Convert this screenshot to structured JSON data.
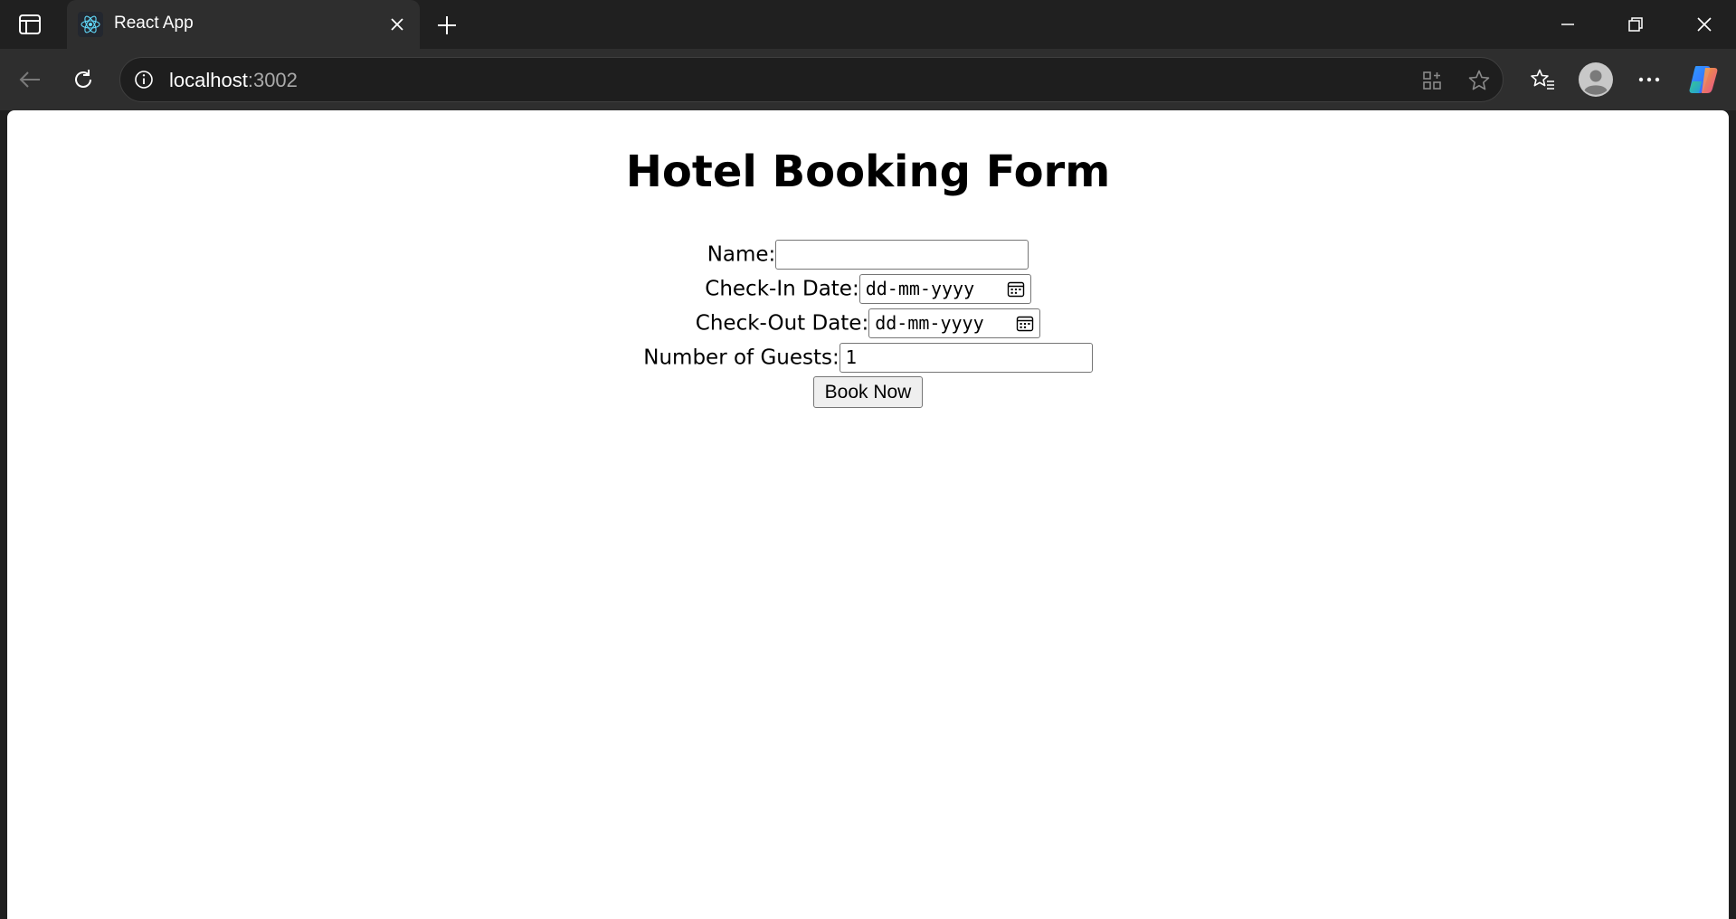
{
  "browser": {
    "tab": {
      "title": "React App",
      "icon": "react-logo-icon"
    },
    "address": {
      "host": "localhost",
      "port": ":3002"
    },
    "accent_color": "#61dafb"
  },
  "page": {
    "title": "Hotel Booking Form",
    "form": {
      "name_label": "Name:",
      "name_value": "",
      "checkin_label": "Check-In Date:",
      "checkin_placeholder": "dd-mm-yyyy",
      "checkout_label": "Check-Out Date:",
      "checkout_placeholder": "dd-mm-yyyy",
      "guests_label": "Number of Guests:",
      "guests_value": "1",
      "submit_label": "Book Now"
    }
  }
}
